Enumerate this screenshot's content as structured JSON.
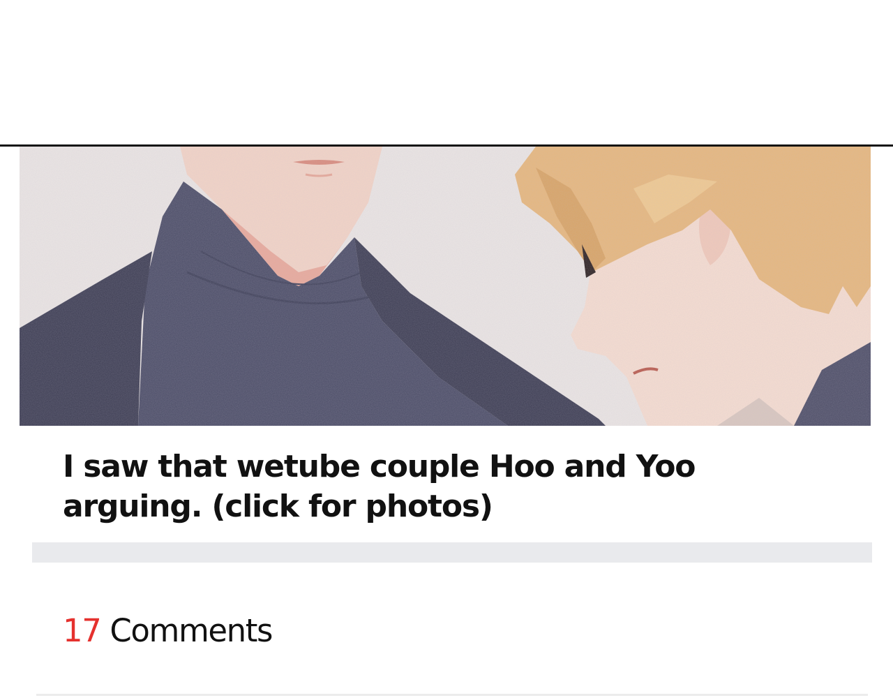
{
  "post": {
    "title": "I saw that wetube couple Hoo and Yoo arguing. (click for photos)",
    "hero_image": "comic panel of two men: dark-haired man in dark turtleneck and coat, blond man looking down"
  },
  "comments": {
    "count": "17",
    "label": "Comments"
  },
  "colors": {
    "accent_count": "#e5312e",
    "divider": "#e9eaed",
    "text": "#111111"
  }
}
